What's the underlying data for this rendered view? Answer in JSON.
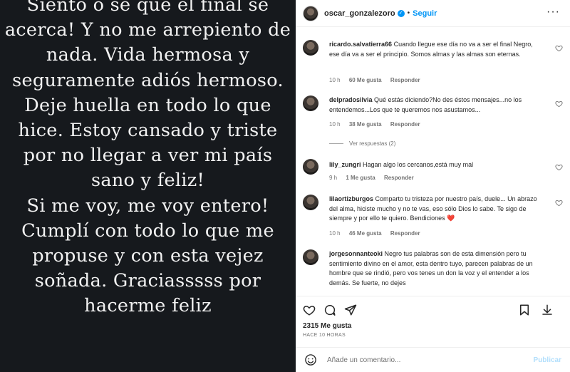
{
  "post": {
    "text": "Siento o sé que el final se acerca! Y no me arrepiento de nada. Vida hermosa y seguramente adiós hermoso. Deje huella en todo lo que hice. Estoy cansado y triste por no llegar a ver mi país sano y feliz!\nSi me voy, me voy entero! Cumplí con todo lo que me propuse y con esta vejez soñada. Graciasssss por hacerme feliz"
  },
  "header": {
    "username": "oscar_gonzalezoro",
    "verified_glyph": "✓",
    "separator": "•",
    "follow_label": "Seguir",
    "more_glyph": "···"
  },
  "comments": [
    {
      "username": "ricardo.salvatierra66",
      "text": "Cuando llegue ese día no va a ser el final Negro, ese día va a ser el principio. Somos almas y las almas son eternas.",
      "time": "10 h",
      "likes": "60 Me gusta",
      "reply": "Responder"
    },
    {
      "username": "delpradosilvia",
      "text": "Qué estás diciendo?No des éstos mensajes...no los entendemos...Los que te queremos nos asustamos...",
      "time": "10 h",
      "likes": "38 Me gusta",
      "reply": "Responder",
      "view_replies": "Ver respuestas (2)"
    },
    {
      "username": "lily_zungri",
      "text": "Hagan algo los cercanos,está muy mal",
      "time": "9 h",
      "likes": "1 Me gusta",
      "reply": "Responder"
    },
    {
      "username": "lilaortizburgos",
      "text": "Comparto tu tristeza por nuestro país, duele... Un abrazo del alma, hiciste mucho y no te vas, eso sólo Dios lo sabe. Te sigo de siempre y por ello te quiero. Bendiciones ❤️",
      "time": "10 h",
      "likes": "46 Me gusta",
      "reply": "Responder"
    },
    {
      "username": "jorgesonnanteoki",
      "text": "Negro tus palabras son de esta dimensión pero tu sentimiento divino en el amor, esta dentro tuyo, parecen palabras de un hombre que se rindió, pero vos tenes un don la voz y el entender a los demás. Se fuerte, no dejes"
    }
  ],
  "stats": {
    "likes": "2315 Me gusta",
    "time": "HACE 10 HORAS"
  },
  "composer": {
    "placeholder": "Añade un comentario...",
    "publish_label": "Publicar"
  }
}
